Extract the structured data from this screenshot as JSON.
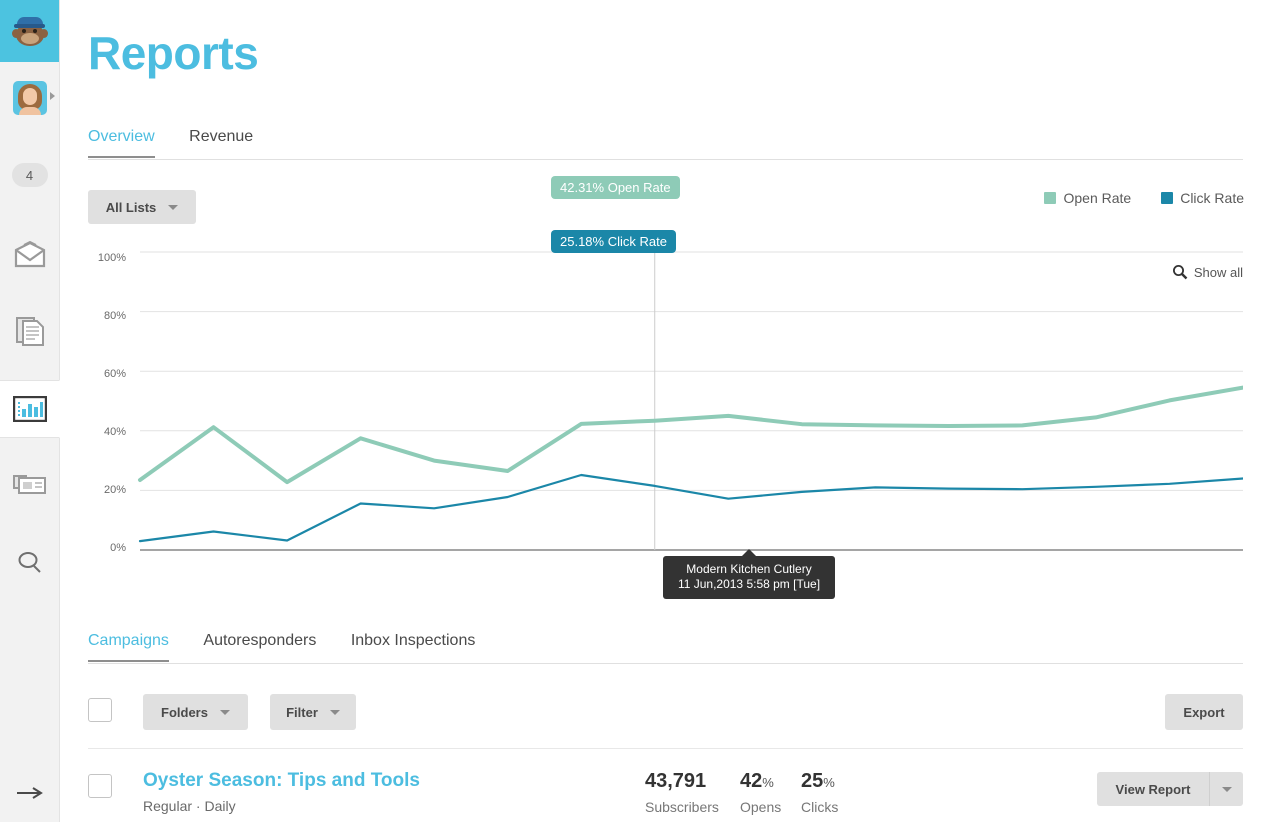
{
  "app": {
    "logo_icon": "mailchimp-monkey-icon",
    "accent": "#4cbde0"
  },
  "sidebar": {
    "avatar": {
      "icon": "user-avatar",
      "expand_icon": "chevron-right-icon"
    },
    "badge": "4",
    "items": [
      {
        "name": "campaigns",
        "icon": "envelope-icon"
      },
      {
        "name": "templates",
        "icon": "document-icon"
      },
      {
        "name": "reports",
        "icon": "bar-chart-icon",
        "active": true
      },
      {
        "name": "lists",
        "icon": "cards-icon"
      },
      {
        "name": "search",
        "icon": "search-icon"
      }
    ],
    "expand_icon": "arrow-right-icon"
  },
  "header": {
    "title": "Reports"
  },
  "top_tabs": [
    {
      "label": "Overview",
      "active": true
    },
    {
      "label": "Revenue",
      "active": false
    }
  ],
  "filters": {
    "all_lists_label": "All Lists",
    "caret_icon": "chevron-down-icon"
  },
  "legend": [
    {
      "label": "Open Rate",
      "color": "#8ecbb7"
    },
    {
      "label": "Click Rate",
      "color": "#1b87a8"
    }
  ],
  "chart_controls": {
    "show_all_label": "Show all",
    "show_all_icon": "magnifier-icon"
  },
  "chart_data": {
    "type": "line",
    "title": "",
    "xlabel": "",
    "ylabel": "",
    "ylim": [
      0,
      100
    ],
    "yticks": [
      "0%",
      "20%",
      "40%",
      "60%",
      "80%",
      "100%"
    ],
    "ytick_values": [
      0,
      20,
      40,
      60,
      80,
      100
    ],
    "grid": true,
    "legend_position": "top-right",
    "x": [
      1,
      2,
      3,
      4,
      5,
      6,
      7,
      8,
      9,
      10,
      11,
      12,
      13,
      14,
      15,
      16
    ],
    "series": [
      {
        "name": "Open Rate",
        "color": "#8ecbb7",
        "values": [
          23.5,
          41.2,
          22.8,
          37.5,
          30.0,
          26.5,
          42.31,
          43.4,
          45.0,
          42.2,
          41.8,
          41.6,
          41.8,
          44.5,
          50.2,
          54.5
        ]
      },
      {
        "name": "Click Rate",
        "color": "#1b87a8",
        "values": [
          3.0,
          6.2,
          3.2,
          15.6,
          14.0,
          17.8,
          25.18,
          21.5,
          17.2,
          19.5,
          21.0,
          20.6,
          20.4,
          21.2,
          22.2,
          24.0
        ]
      }
    ],
    "annotations": [
      {
        "type": "value-pill",
        "series": "Open Rate",
        "text": "42.31% Open Rate"
      },
      {
        "type": "value-pill",
        "series": "Click Rate",
        "text": "25.18% Click Rate"
      }
    ],
    "cursor": {
      "x_index": 7,
      "tooltip_title": "Modern Kitchen Cutlery",
      "tooltip_date": "11 Jun,2013 5:58 pm [Tue]"
    }
  },
  "lower_tabs": [
    {
      "label": "Campaigns",
      "active": true
    },
    {
      "label": "Autoresponders",
      "active": false
    },
    {
      "label": "Inbox Inspections",
      "active": false
    }
  ],
  "toolbar": {
    "select_all_checkbox": "",
    "folders_label": "Folders",
    "filter_label": "Filter",
    "export_label": "Export"
  },
  "campaigns": [
    {
      "name": "Oyster Season: Tips and Tools",
      "subtitle": "Regular · Daily",
      "subscribers": "43,791",
      "subscribers_label": "Subscribers",
      "opens": "42",
      "opens_unit": "%",
      "opens_label": "Opens",
      "clicks": "25",
      "clicks_unit": "%",
      "clicks_label": "Clicks",
      "view_report_label": "View Report",
      "view_report_caret": "chevron-down-icon"
    }
  ]
}
